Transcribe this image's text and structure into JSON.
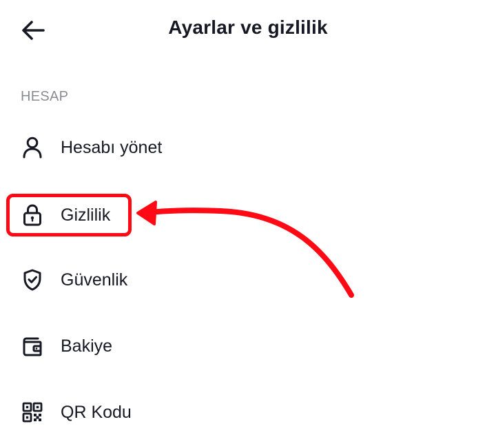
{
  "header": {
    "title": "Ayarlar ve gizlilik",
    "back_icon": "arrow-left-icon"
  },
  "section": {
    "title": "HESAP"
  },
  "menu": {
    "items": [
      {
        "label": "Hesabı yönet",
        "icon": "person-icon"
      },
      {
        "label": "Gizlilik",
        "icon": "lock-icon"
      },
      {
        "label": "Güvenlik",
        "icon": "shield-check-icon"
      },
      {
        "label": "Bakiye",
        "icon": "wallet-icon"
      },
      {
        "label": "QR Kodu",
        "icon": "qr-code-icon"
      }
    ]
  },
  "annotation": {
    "color": "#ff0a14",
    "highlighted_item": "Gizlilik"
  },
  "colors": {
    "text": "#161823",
    "section_header": "#8a8b91",
    "background": "#ffffff"
  }
}
